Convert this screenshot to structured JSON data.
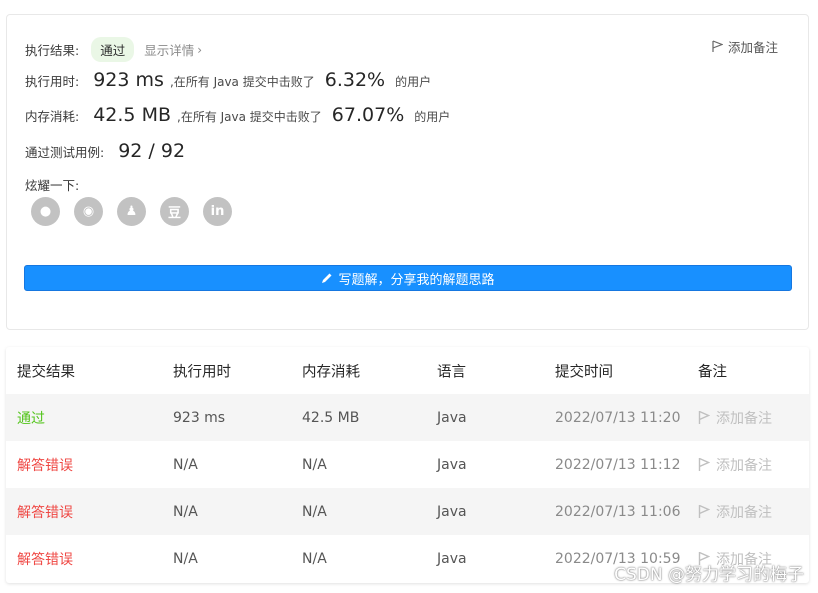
{
  "summary": {
    "result_label": "执行结果:",
    "result_status": "通过",
    "detail_link": "显示详情",
    "add_note": "添加备注",
    "time_label": "执行用时:",
    "time_value": "923 ms",
    "time_text": ",在所有 Java 提交中击败了",
    "time_pct": "6.32%",
    "time_tail": "的用户",
    "mem_label": "内存消耗:",
    "mem_value": "42.5 MB",
    "mem_text": ",在所有 Java 提交中击败了",
    "mem_pct": "67.07%",
    "mem_tail": "的用户",
    "tests_label": "通过测试用例:",
    "tests_value": "92 / 92",
    "share_label": "炫耀一下:",
    "share_icons": [
      "wechat-icon",
      "weibo-icon",
      "qq-icon",
      "douban-icon",
      "linkedin-icon"
    ],
    "share_glyphs": [
      "●",
      "◉",
      "♟",
      "豆",
      "in"
    ],
    "write_button": "写题解，分享我的解题思路"
  },
  "table": {
    "headers": [
      "提交结果",
      "执行用时",
      "内存消耗",
      "语言",
      "提交时间",
      "备注"
    ],
    "rows": [
      {
        "status": "通过",
        "status_kind": "ok",
        "time": "923 ms",
        "memory": "42.5 MB",
        "language": "Java",
        "submitted": "2022/07/13 11:20",
        "note": "添加备注"
      },
      {
        "status": "解答错误",
        "status_kind": "err",
        "time": "N/A",
        "memory": "N/A",
        "language": "Java",
        "submitted": "2022/07/13 11:12",
        "note": "添加备注"
      },
      {
        "status": "解答错误",
        "status_kind": "err",
        "time": "N/A",
        "memory": "N/A",
        "language": "Java",
        "submitted": "2022/07/13 11:06",
        "note": "添加备注"
      },
      {
        "status": "解答错误",
        "status_kind": "err",
        "time": "N/A",
        "memory": "N/A",
        "language": "Java",
        "submitted": "2022/07/13 10:59",
        "note": "添加备注"
      }
    ]
  },
  "watermark": "CSDN @努力学习的梅子",
  "colors": {
    "accent": "#1890ff",
    "success": "#52c41a",
    "error": "#ef4743",
    "muted": "#8a8a8a"
  }
}
